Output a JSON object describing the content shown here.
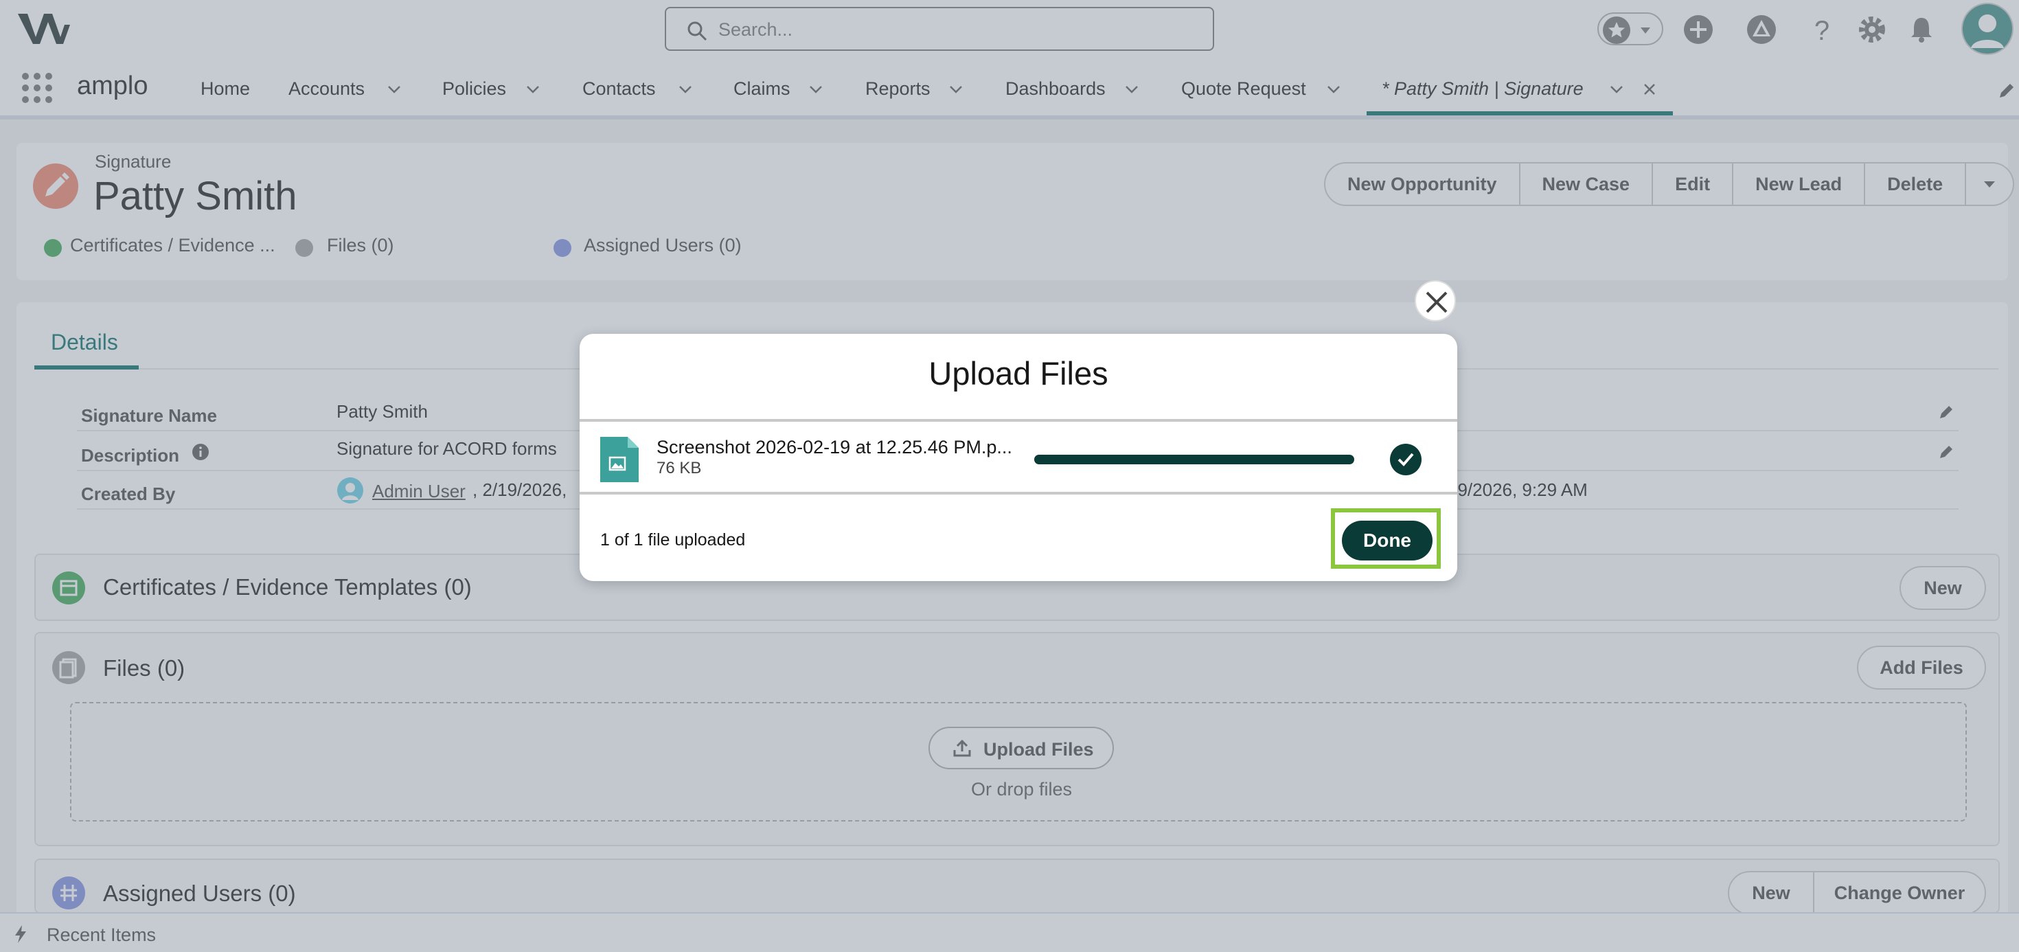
{
  "header": {
    "search_placeholder": "Search...",
    "icons": [
      "logo-icon",
      "search-icon",
      "favorites-star-icon",
      "add-icon",
      "trailhead-icon",
      "help-icon",
      "setup-gear-icon",
      "notifications-bell-icon",
      "user-avatar-icon"
    ]
  },
  "nav": {
    "app_name": "amplo",
    "items": [
      {
        "label": "Home",
        "has_menu": false
      },
      {
        "label": "Accounts",
        "has_menu": true
      },
      {
        "label": "Policies",
        "has_menu": true
      },
      {
        "label": "Contacts",
        "has_menu": true
      },
      {
        "label": "Claims",
        "has_menu": true
      },
      {
        "label": "Reports",
        "has_menu": true
      },
      {
        "label": "Dashboards",
        "has_menu": true
      },
      {
        "label": "Quote Request",
        "has_menu": true
      }
    ],
    "active_tab": "* Patty Smith | Signature"
  },
  "record": {
    "object_type": "Signature",
    "name": "Patty Smith",
    "actions": [
      "New Opportunity",
      "New Case",
      "Edit",
      "New Lead",
      "Delete"
    ],
    "related_links": [
      {
        "label": "Certificates / Evidence ...",
        "color": "#3ba755"
      },
      {
        "label": "Files (0)",
        "color": "#9e9e9e"
      },
      {
        "label": "Assigned Users (0)",
        "color": "#7f8de1"
      }
    ]
  },
  "details": {
    "tab": "Details",
    "fields": [
      {
        "label": "Signature Name",
        "value": "Patty Smith"
      },
      {
        "label": "Description",
        "value": "Signature for ACORD forms"
      },
      {
        "label": "Created By",
        "user": "Admin User",
        "value": ", 2/19/2026,",
        "right_value": "19/2026, 9:29 AM"
      }
    ]
  },
  "related_lists": {
    "certificates": {
      "title": "Certificates / Evidence Templates (0)",
      "button": "New"
    },
    "files": {
      "title": "Files (0)",
      "button": "Add Files",
      "upload_button": "Upload Files",
      "drop_text": "Or drop files"
    },
    "assigned_users": {
      "title": "Assigned Users (0)",
      "buttons": [
        "New",
        "Change Owner"
      ]
    }
  },
  "footer": {
    "label": "Recent Items"
  },
  "modal": {
    "title": "Upload Files",
    "file_name": "Screenshot 2026-02-19 at 12.25.46 PM.p...",
    "file_size": "76 KB",
    "progress": 1.0,
    "status": "1 of 1 file uploaded",
    "done_label": "Done"
  },
  "colors": {
    "brand": "#016b64",
    "dark_teal": "#0b3b37",
    "highlight": "#8cc63f",
    "record_icon": "#f0816a"
  }
}
